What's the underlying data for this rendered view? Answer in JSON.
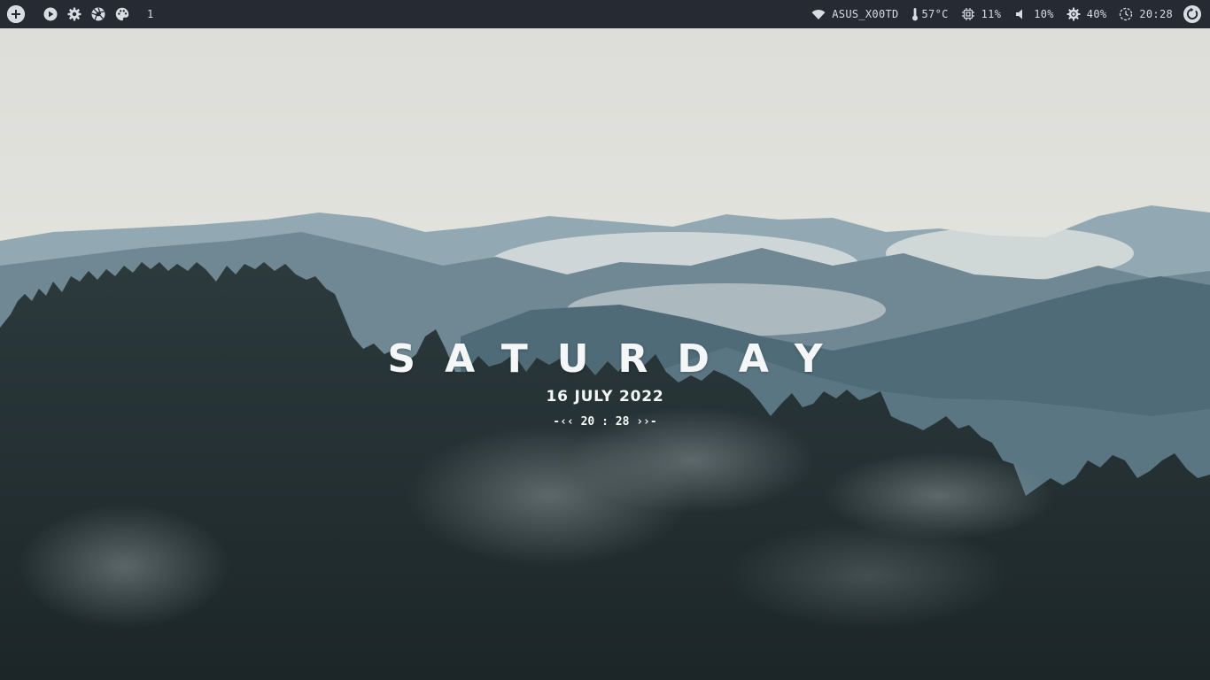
{
  "topbar": {
    "left": {
      "launcher_icon": "plus-circle-icon",
      "buttons": [
        {
          "icon": "play-circle-icon"
        },
        {
          "icon": "gear-icon"
        },
        {
          "icon": "aperture-icon"
        },
        {
          "icon": "palette-icon"
        }
      ],
      "workspace": "1"
    },
    "right": {
      "wifi": {
        "icon": "wifi-icon",
        "label": "ASUS_X00TD"
      },
      "temperature": {
        "icon": "thermometer-icon",
        "label": "57°C"
      },
      "cpu": {
        "icon": "cpu-icon",
        "label": "11%"
      },
      "volume": {
        "icon": "speaker-icon",
        "label": "10%"
      },
      "brightness": {
        "icon": "brightness-icon",
        "label": "40%"
      },
      "clock": {
        "icon": "clock-icon",
        "label": "20:28"
      },
      "power_icon": "power-icon"
    }
  },
  "widget": {
    "day": "SATURDAY",
    "date": "16 JULY 2022",
    "time": "-‹‹ 20 : 28 ››-"
  },
  "colors": {
    "bar_bg": "#262a33",
    "bar_fg": "#d8dce3",
    "text": "#f4f6f7"
  }
}
